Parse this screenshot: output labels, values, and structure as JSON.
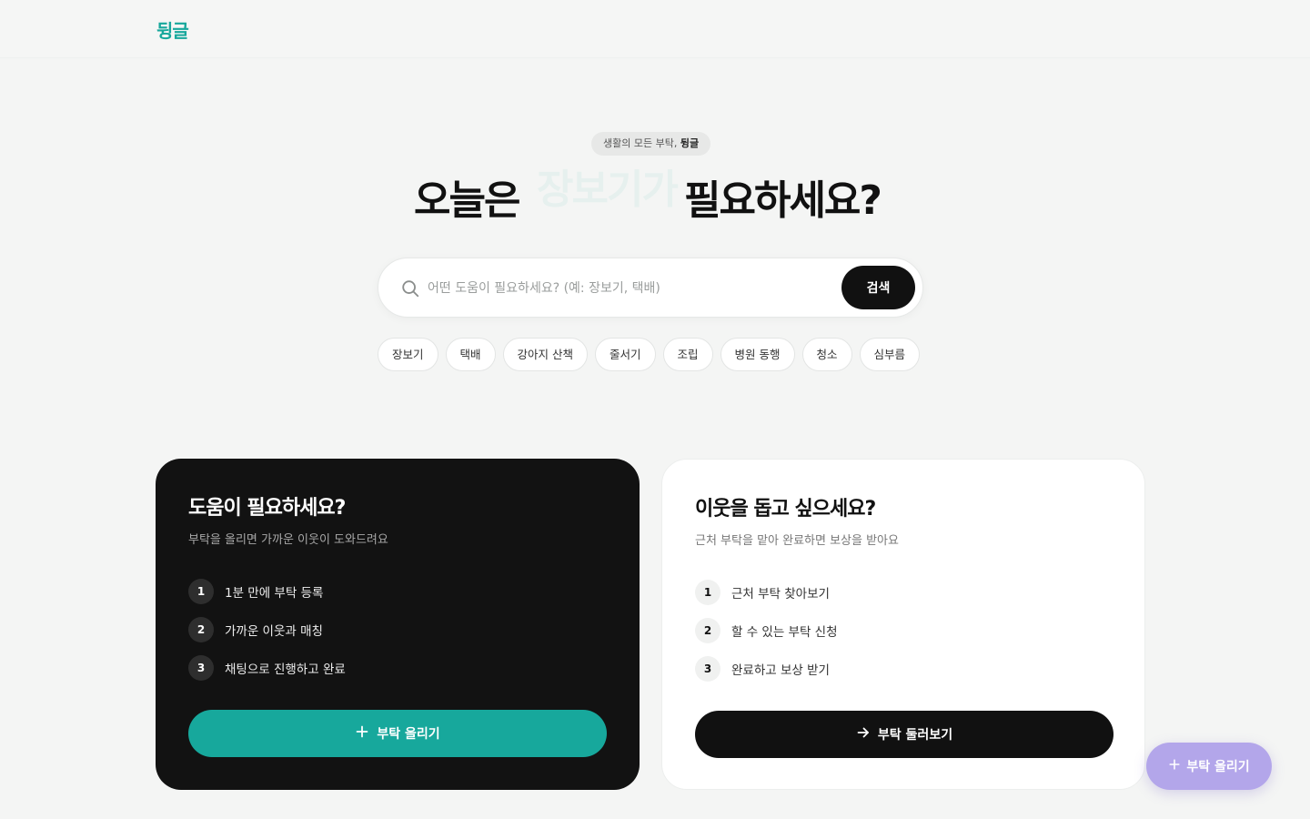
{
  "header": {
    "logo": "뒹글"
  },
  "hero": {
    "badge_prefix": "생활의 모든 부탁, ",
    "badge_brand": "뒹글",
    "title_left": "오늘은",
    "title_rotating": "장보기가",
    "title_right": "필요하세요?"
  },
  "search": {
    "placeholder": "어떤 도움이 필요하세요? (예: 장보기, 택배)",
    "value": "",
    "button_label": "검색"
  },
  "chips": [
    "장보기",
    "택배",
    "강아지 산책",
    "줄서기",
    "조립",
    "병원 동행",
    "청소",
    "심부름"
  ],
  "cards": {
    "request": {
      "title": "도움이 필요하세요?",
      "subtitle": "부탁을 올리면 가까운 이웃이 도와드려요",
      "steps": [
        {
          "num": "1",
          "label": "1분 만에 부탁 등록"
        },
        {
          "num": "2",
          "label": "가까운 이웃과 매칭"
        },
        {
          "num": "3",
          "label": "채팅으로 진행하고 완료"
        }
      ],
      "cta_label": "부탁 올리기"
    },
    "help": {
      "title": "이웃을 돕고 싶으세요?",
      "subtitle": "근처 부탁을 맡아 완료하면 보상을 받아요",
      "steps": [
        {
          "num": "1",
          "label": "근처 부탁 찾아보기"
        },
        {
          "num": "2",
          "label": "할 수 있는 부탁 신청"
        },
        {
          "num": "3",
          "label": "완료하고 보상 받기"
        }
      ],
      "cta_label": "부탁 둘러보기"
    }
  },
  "fab": {
    "label": "부탁 올리기"
  },
  "colors": {
    "brand": "#17a89c",
    "dark": "#121212",
    "fab": "#b3a6ea",
    "background": "#f4f5f4"
  },
  "icons": {
    "search": "search-icon",
    "plus": "plus-icon",
    "arrow": "arrow-right-icon"
  }
}
